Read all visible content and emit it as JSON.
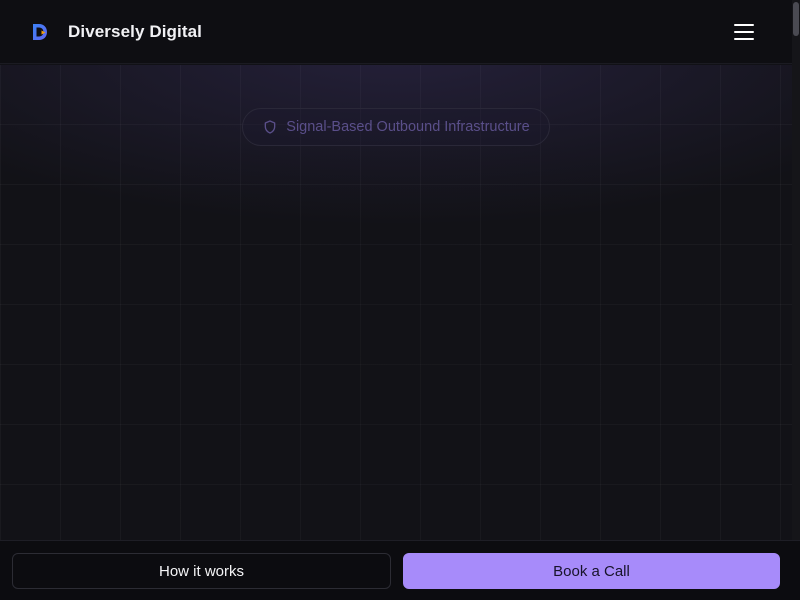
{
  "header": {
    "brand_name": "Diversely Digital",
    "logo_icon": "d-monogram-logo",
    "menu_icon": "hamburger-menu-icon"
  },
  "hero": {
    "badge_text": "Signal-Based Outbound Infrastructure",
    "badge_icon": "shield-icon"
  },
  "actions": {
    "secondary_label": "How it works",
    "primary_label": "Book a Call"
  },
  "colors": {
    "accent": "#a78bfa",
    "background": "#111116",
    "badge_text": "#5a4f8a"
  }
}
